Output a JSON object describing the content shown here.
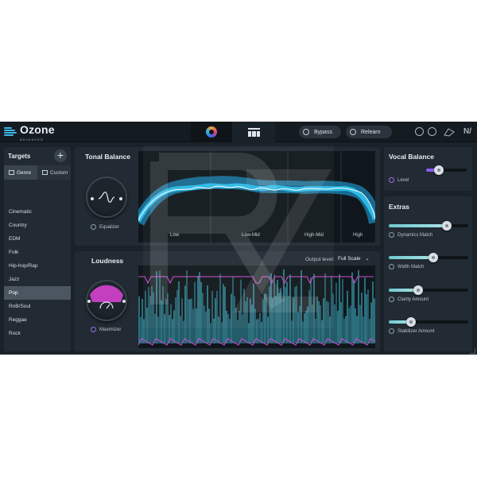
{
  "brand": {
    "name": "Ozone",
    "edition": "ADVANCED"
  },
  "topbar": {
    "bypass_label": "Bypass",
    "relearn_label": "Relearn"
  },
  "targets": {
    "title": "Targets",
    "genre_tab": "Genre",
    "custom_tab": "Custom",
    "genres": [
      "Cinematic",
      "Country",
      "EDM",
      "Folk",
      "Hip-hop/Rap",
      "Jazz",
      "Pop",
      "RnB/Soul",
      "Reggae",
      "Rock"
    ],
    "selected": "Pop"
  },
  "tonal_balance": {
    "title": "Tonal Balance",
    "module_label": "Equalizer",
    "bands": [
      "Low",
      "Low-Mid",
      "High-Mid",
      "High"
    ]
  },
  "loudness": {
    "title": "Loudness",
    "module_label": "Maximizer",
    "output_label": "Output level:",
    "output_value": "Full Scale"
  },
  "vocal_balance": {
    "title": "Vocal Balance",
    "level_label": "Level",
    "level_value": 0.3
  },
  "extras": {
    "title": "Extras",
    "sliders": [
      {
        "label": "Dynamics Match",
        "value": 0.73
      },
      {
        "label": "Width Match",
        "value": 0.56
      },
      {
        "label": "Clarity Amount",
        "value": 0.37
      },
      {
        "label": "Stabilizer Amount",
        "value": 0.28
      }
    ]
  },
  "colors": {
    "accent_cyan": "#3fc4ec",
    "accent_magenta": "#d44bd4",
    "accent_purple": "#8a5cf0"
  }
}
